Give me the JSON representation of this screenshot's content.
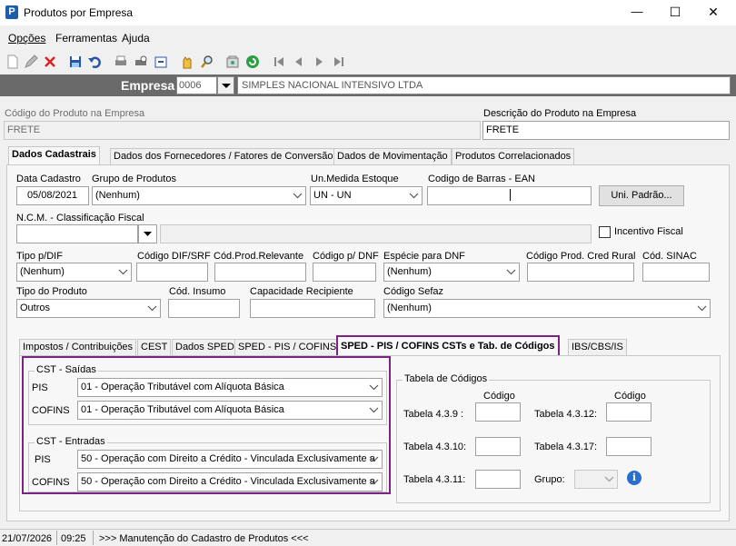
{
  "window": {
    "title": "Produtos por Empresa",
    "minimize": "—",
    "maximize": "☐",
    "close": "✕"
  },
  "menu": {
    "items": [
      "Opções",
      "Ferramentas",
      "Ajuda"
    ]
  },
  "empresa": {
    "label": "Empresa",
    "code": "0006",
    "name": "SIMPLES NACIONAL INTENSIVO LTDA"
  },
  "produto": {
    "codigo_label": "Código do Produto na Empresa",
    "codigo_value": "FRETE",
    "descricao_label": "Descrição do Produto na Empresa",
    "descricao_value": "FRETE"
  },
  "main_tabs": [
    "Dados Cadastrais",
    "Dados dos Fornecedores / Fatores de Conversão",
    "Dados de Movimentação",
    "Produtos Correlacionados"
  ],
  "form": {
    "data_cadastro_label": "Data Cadastro",
    "data_cadastro_value": "05/08/2021",
    "grupo_label": "Grupo de Produtos",
    "grupo_value": "(Nenhum)",
    "un_medida_label": "Un.Medida Estoque",
    "un_medida_value": "UN - UN",
    "ean_label": "Codigo de Barras - EAN",
    "ean_value": "",
    "uni_padrao_button": "Uni. Padrão...",
    "ncm_label": "N.C.M. -  Classificação Fiscal",
    "ncm_value": "",
    "ncm_desc_value": "",
    "incentivo_label": "Incentivo Fiscal",
    "incentivo_checked": false,
    "tipo_dif_label": "Tipo p/DIF",
    "tipo_dif_value": "(Nenhum)",
    "codigo_dif_label": "Código DIF/SRF",
    "codigo_dif_value": "",
    "cod_relevante_label": "Cód.Prod.Relevante",
    "cod_relevante_value": "",
    "codigo_dnf_label": "Código p/ DNF",
    "codigo_dnf_value": "",
    "especie_dnf_label": "Espécie para DNF",
    "especie_dnf_value": "(Nenhum)",
    "cred_rural_label": "Código Prod. Cred Rural",
    "cred_rural_value": "",
    "sinac_label": "Cód. SINAC",
    "sinac_value": "",
    "tipo_produto_label": "Tipo do Produto",
    "tipo_produto_value": "Outros",
    "insumo_label": "Cód. Insumo",
    "insumo_value": "",
    "capacidade_label": "Capacidade Recipiente",
    "capacidade_value": "",
    "sefaz_label": "Código Sefaz",
    "sefaz_value": "(Nenhum)"
  },
  "sub_tabs": [
    "Impostos / Contribuições",
    "CEST",
    "Dados SPED",
    "SPED - PIS / COFINS",
    "SPED - PIS / COFINS CSTs e Tab. de Códigos",
    "IBS/CBS/IS"
  ],
  "cst": {
    "saidas_title": "CST - Saídas",
    "pis_label": "PIS",
    "pis_saida": "01 - Operação Tributável com Alíquota Básica",
    "cofins_label": "COFINS",
    "cofins_saida": "01 - Operação Tributável com Alíquota Básica",
    "entradas_title": "CST - Entradas",
    "pis_entrada": "50 - Operação com Direito a Crédito - Vinculada Exclusivamente a",
    "cofins_entrada": "50 - Operação com Direito a Crédito - Vinculada Exclusivamente a"
  },
  "tabela": {
    "title": "Tabela de Códigos",
    "codigo_header": "Código",
    "t439": "Tabela 4.3.9 :",
    "t4310": "Tabela 4.3.10:",
    "t4311": "Tabela 4.3.11:",
    "t4312": "Tabela 4.3.12:",
    "t4317": "Tabela 4.3.17:",
    "grupo": "Grupo:"
  },
  "status": {
    "date": "21/07/2026",
    "time": "09:25",
    "message": ">>> Manutenção do Cadastro de Produtos <<<"
  },
  "colors": {
    "accent": "#7b2383",
    "empresa_bar": "#6a6a6a"
  }
}
